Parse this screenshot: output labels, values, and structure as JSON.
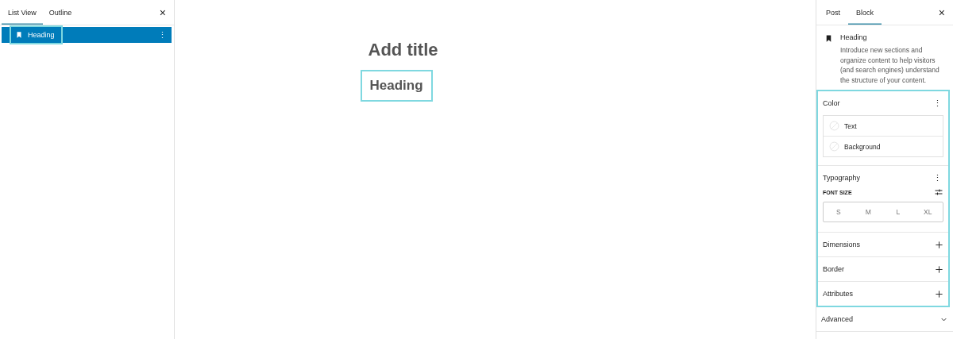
{
  "list_view": {
    "tabs": [
      {
        "label": "List View",
        "selected": true
      },
      {
        "label": "Outline",
        "selected": false
      }
    ],
    "close": "×",
    "items": [
      {
        "label": "Heading",
        "selected": true,
        "highlighted": true,
        "menu": "⋮"
      }
    ]
  },
  "editor": {
    "title_placeholder": "Add title",
    "blocks": [
      {
        "text": "Heading",
        "highlighted": true
      }
    ]
  },
  "settings": {
    "tabs": [
      {
        "label": "Post",
        "selected": false
      },
      {
        "label": "Block",
        "selected": true
      }
    ],
    "close": "×",
    "block_card": {
      "title": "Heading",
      "description": "Introduce new sections and organize content to help visitors (and search engines) understand the structure of your content."
    },
    "panels": [
      {
        "kind": "color",
        "title": "Color",
        "highlighted": true,
        "menu": "⋮",
        "options": [
          {
            "label": "Text",
            "set": false
          },
          {
            "label": "Background",
            "set": false
          }
        ]
      },
      {
        "kind": "typography",
        "title": "Typography",
        "highlighted": true,
        "menu": "⋮",
        "font_size_label": "FONT SIZE",
        "sizes": [
          {
            "label": "S",
            "selected": false
          },
          {
            "label": "M",
            "selected": false
          },
          {
            "label": "L",
            "selected": false
          },
          {
            "label": "XL",
            "selected": false
          }
        ]
      },
      {
        "kind": "tool",
        "title": "Dimensions",
        "highlighted": true
      },
      {
        "kind": "tool",
        "title": "Border",
        "highlighted": true
      },
      {
        "kind": "tool",
        "title": "Attributes",
        "highlighted": true
      },
      {
        "kind": "advanced",
        "title": "Advanced",
        "highlighted": false
      }
    ]
  }
}
